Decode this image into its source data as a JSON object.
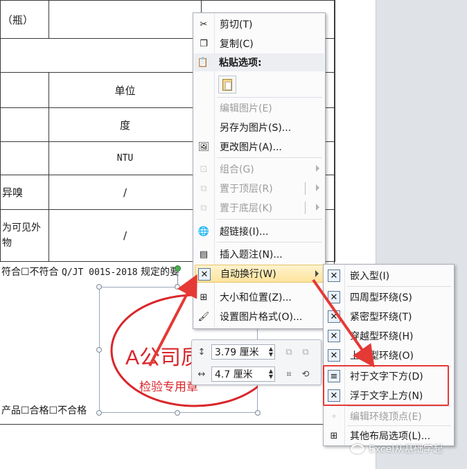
{
  "document": {
    "table_rows": [
      {
        "c0": "（瓶）",
        "c1": "",
        "c2": ""
      },
      {
        "c0": "",
        "c1": "",
        "c2": ""
      },
      {
        "c0": "",
        "c1": "单位",
        "c2": ""
      },
      {
        "c0": "",
        "c1": "度",
        "c2": ""
      },
      {
        "c0": "",
        "c1": "NTU",
        "c2": ""
      },
      {
        "c0": "异嗅",
        "c1": "/",
        "c2": ""
      },
      {
        "c0": "为可见外物",
        "c1": "/",
        "c2": ""
      }
    ],
    "line1_prefix": "符合☐不符合",
    "line1_standard": "Q/JT 001S-2018",
    "line1_suffix": "规定的要",
    "line2": "产品☐合格☐不合格"
  },
  "stamp": {
    "title": "A公司质",
    "subtitle": "检验专用章",
    "color": "#d9262b"
  },
  "context_menu": {
    "items": [
      {
        "label": "剪切(T)",
        "icon": "scissors-icon",
        "enabled": true
      },
      {
        "label": "复制(C)",
        "icon": "copy-icon",
        "enabled": true
      },
      {
        "label": "粘贴选项:",
        "icon": "paste-icon",
        "enabled": true
      },
      {
        "label": "编辑图片(E)",
        "enabled": false
      },
      {
        "label": "另存为图片(S)...",
        "enabled": true
      },
      {
        "label": "更改图片(A)...",
        "icon": "change-picture-icon",
        "enabled": true
      },
      {
        "label": "组合(G)",
        "icon": "group-icon",
        "enabled": false
      },
      {
        "label": "置于顶层(R)",
        "icon": "bring-to-front-icon",
        "enabled": false
      },
      {
        "label": "置于底层(K)",
        "icon": "send-to-back-icon",
        "enabled": false
      },
      {
        "label": "超链接(I)...",
        "icon": "hyperlink-icon",
        "enabled": true
      },
      {
        "label": "插入题注(N)...",
        "icon": "insert-caption-icon",
        "enabled": true
      },
      {
        "label": "自动换行(W)",
        "icon": "text-wrap-icon",
        "enabled": true
      },
      {
        "label": "大小和位置(Z)...",
        "icon": "size-position-icon",
        "enabled": true
      },
      {
        "label": "设置图片格式(O)...",
        "icon": "format-picture-icon",
        "enabled": true
      }
    ]
  },
  "wrap_submenu": {
    "items": [
      {
        "label": "嵌入型(I)",
        "enabled": true
      },
      {
        "label": "四周型环绕(S)",
        "enabled": true
      },
      {
        "label": "紧密型环绕(T)",
        "enabled": true
      },
      {
        "label": "穿越型环绕(H)",
        "enabled": true
      },
      {
        "label": "上下型环绕(O)",
        "enabled": true
      },
      {
        "label": "衬于文字下方(D)",
        "enabled": true
      },
      {
        "label": "浮于文字上方(N)",
        "enabled": true
      },
      {
        "label": "编辑环绕顶点(E)",
        "enabled": false
      },
      {
        "label": "其他布局选项(L)...",
        "enabled": true
      }
    ]
  },
  "mini_toolbar": {
    "height_value": "3.79 厘米",
    "width_value": "4.7 厘米"
  },
  "watermark": "Excel从基础学起",
  "colors": {
    "highlight_red": "#e53935",
    "menu_hover": "#fde39c"
  }
}
